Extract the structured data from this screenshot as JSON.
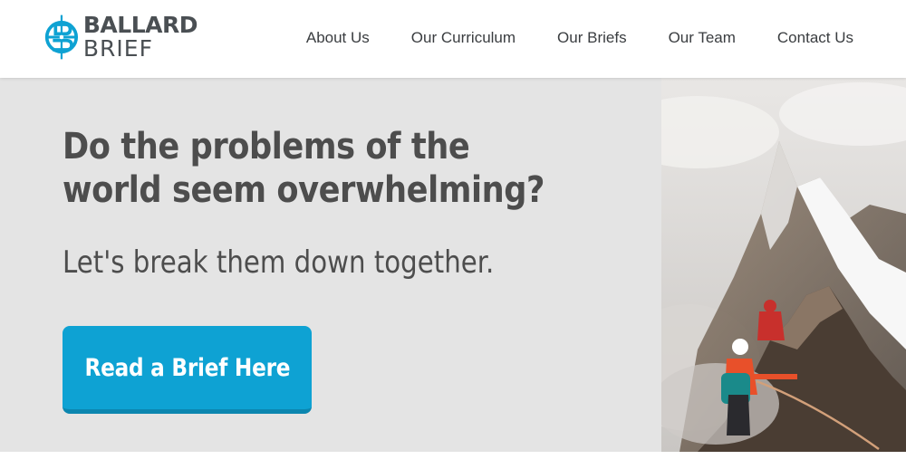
{
  "brand": {
    "name_line1": "BALLARD",
    "name_line2": "BRIEF",
    "logo_icon": "ballard-brief-monogram",
    "logo_color": "#0ea2d3",
    "text_color": "#4a4f53"
  },
  "nav": {
    "items": [
      {
        "label": "About Us"
      },
      {
        "label": "Our Curriculum"
      },
      {
        "label": "Our Briefs"
      },
      {
        "label": "Our Team"
      },
      {
        "label": "Contact Us"
      }
    ]
  },
  "hero": {
    "headline": "Do the problems of the world seem overwhelming?",
    "subheadline": "Let's break them down together.",
    "cta_label": "Read a Brief Here",
    "cta_color": "#0ea2d3",
    "background_color": "#e4e4e4",
    "image_subject": "mountain-climbers-image"
  }
}
